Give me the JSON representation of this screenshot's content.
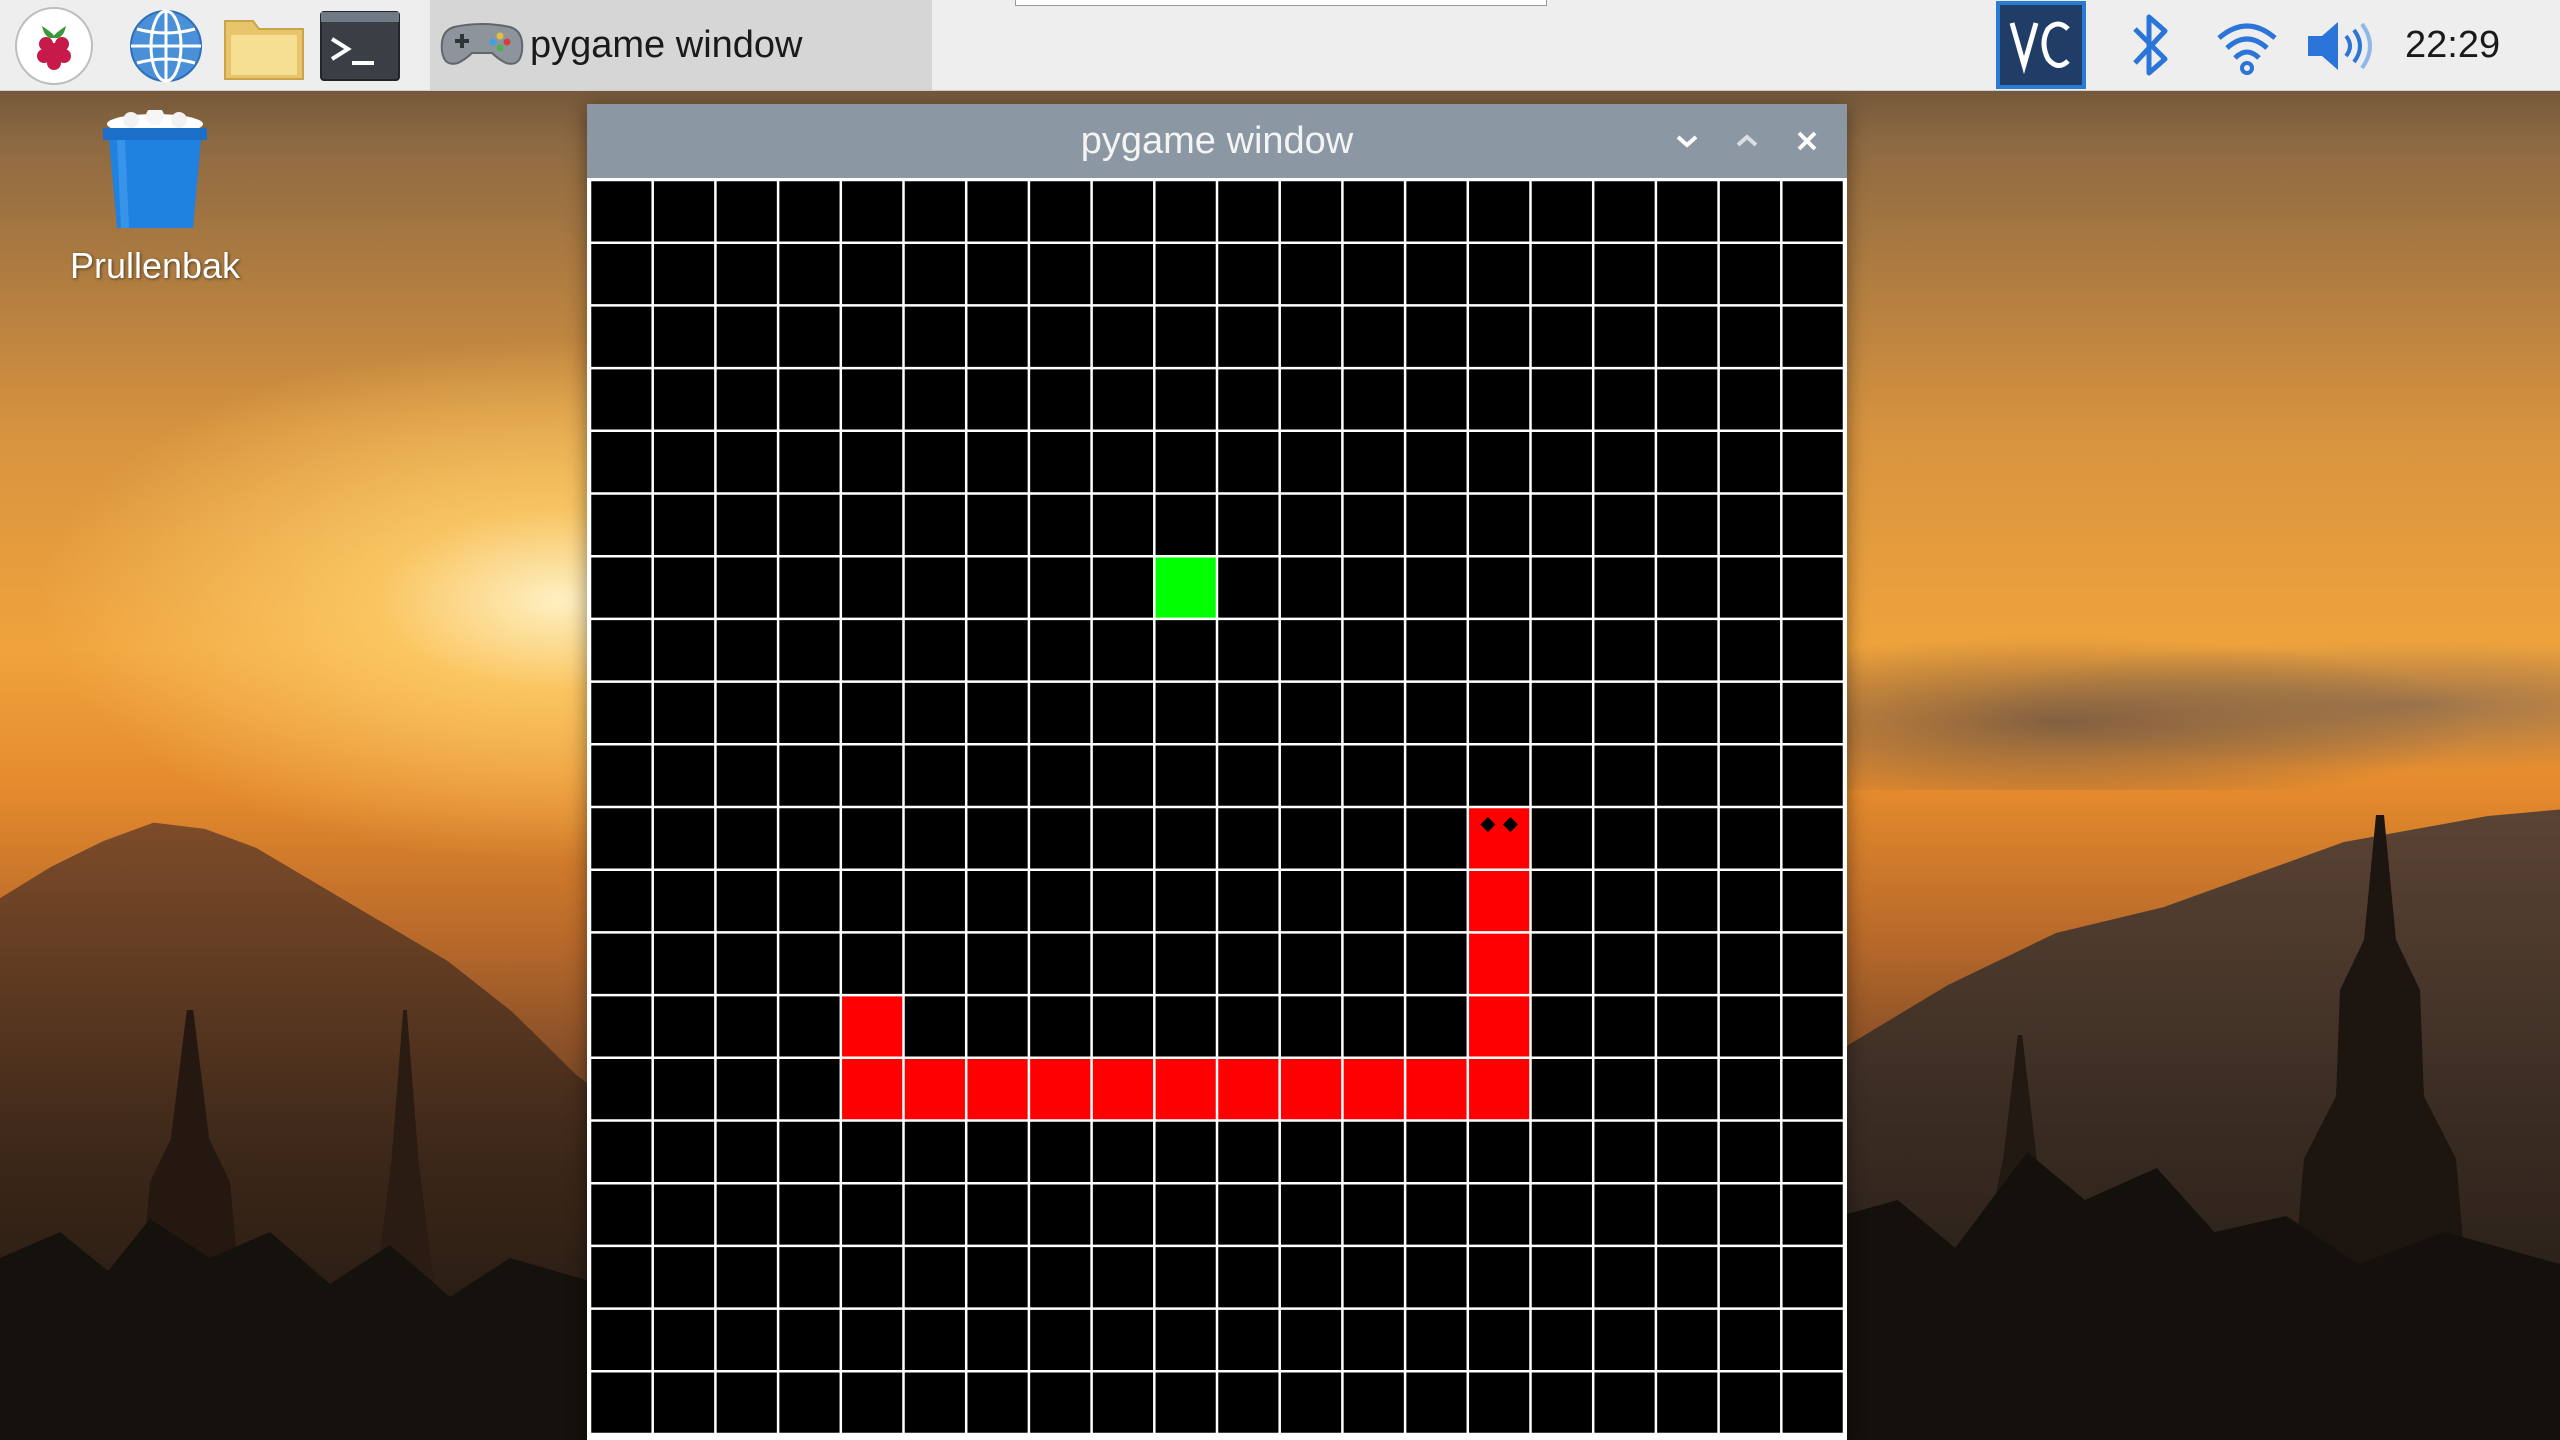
{
  "taskbar": {
    "icons": [
      "raspberry-menu-icon",
      "web-browser-icon",
      "file-manager-icon",
      "terminal-icon"
    ],
    "task_item": {
      "label": "pygame window",
      "icon": "gamepad-icon"
    },
    "tray_icons": [
      "vnc-icon",
      "bluetooth-icon",
      "wifi-icon",
      "volume-icon"
    ],
    "clock": "22:29",
    "accent": "#1f5fbf"
  },
  "desktop": {
    "trash_label": "Prullenbak"
  },
  "window": {
    "title": "pygame window",
    "controls": [
      "minimize-icon",
      "maximize-icon",
      "close-icon"
    ]
  },
  "game": {
    "grid_cols": 20,
    "grid_rows": 20,
    "colors": {
      "background": "#000000",
      "grid": "#ffffff",
      "snake": "#ff0000",
      "food": "#00ff00",
      "eyes": "#000000"
    },
    "food": [
      9,
      6
    ],
    "snake": [
      [
        14,
        10
      ],
      [
        14,
        11
      ],
      [
        14,
        12
      ],
      [
        14,
        13
      ],
      [
        14,
        14
      ],
      [
        13,
        14
      ],
      [
        12,
        14
      ],
      [
        11,
        14
      ],
      [
        10,
        14
      ],
      [
        9,
        14
      ],
      [
        8,
        14
      ],
      [
        7,
        14
      ],
      [
        6,
        14
      ],
      [
        5,
        14
      ],
      [
        4,
        14
      ],
      [
        4,
        13
      ]
    ]
  }
}
